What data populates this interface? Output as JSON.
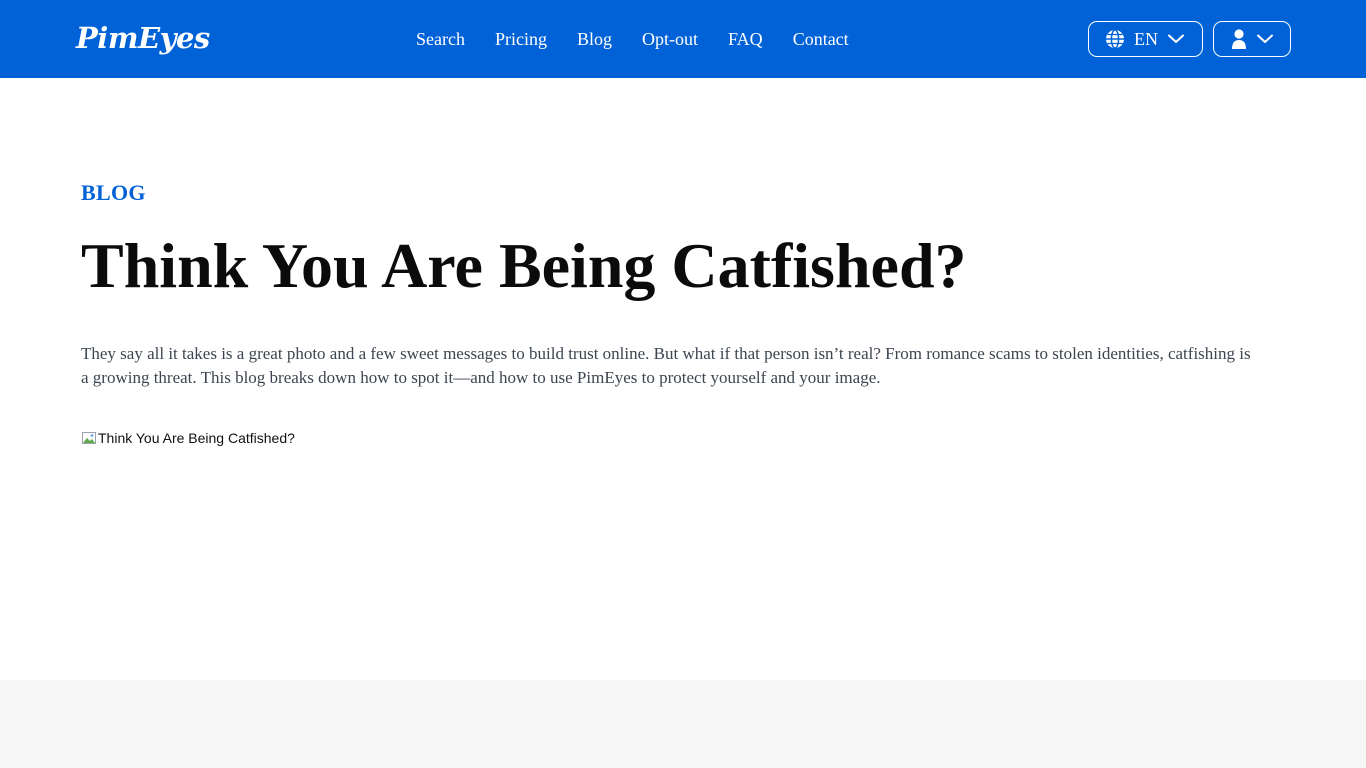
{
  "header": {
    "logo_text": "PimEyes",
    "nav": [
      {
        "label": "Search"
      },
      {
        "label": "Pricing"
      },
      {
        "label": "Blog"
      },
      {
        "label": "Opt-out"
      },
      {
        "label": "FAQ"
      },
      {
        "label": "Contact"
      }
    ],
    "language_button": {
      "label": "EN",
      "icon": "globe-icon"
    },
    "account_button": {
      "icon": "user-icon"
    }
  },
  "article": {
    "kicker": "BLOG",
    "title": "Think You Are Being Catfished?",
    "intro": "They say all it takes is a great photo and a few sweet messages to build trust online. But what if that person isn’t real? From romance scams to stolen identities, catfishing is a growing threat. This blog breaks down how to spot it—and how to use PimEyes to protect yourself and your image.",
    "hero_image_alt": "Think You Are Being Catfished?"
  },
  "colors": {
    "brand_blue": "#0062d6",
    "text_dark": "#0b0b0b",
    "text_muted": "#3c4550",
    "footer_band": "#f6f6f6"
  }
}
